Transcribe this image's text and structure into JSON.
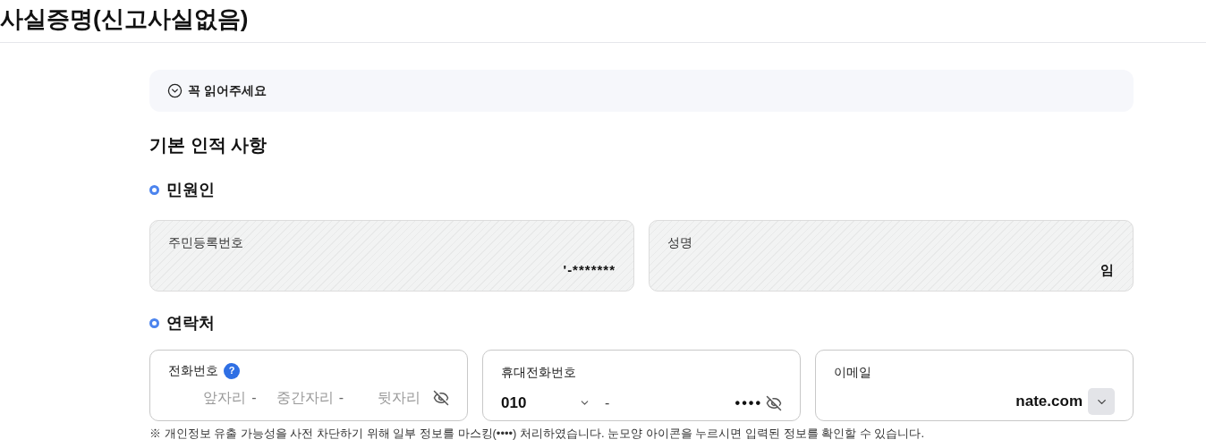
{
  "page_title": "사실증명(신고사실없음)",
  "notice": {
    "label": "꼭 읽어주세요",
    "expanded": false
  },
  "section_title": "기본 인적 사항",
  "applicant": {
    "title": "민원인",
    "fields": [
      {
        "label": "주민등록번호",
        "value": "'-*******"
      },
      {
        "label": "성명",
        "value": "임"
      }
    ]
  },
  "contact": {
    "title": "연락처",
    "phone": {
      "label": "전화번호",
      "help": "?",
      "parts": [
        {
          "placeholder": "앞자리",
          "sep": "-"
        },
        {
          "placeholder": "중간자리",
          "sep": "-"
        },
        {
          "placeholder": "뒷자리"
        }
      ]
    },
    "mobile": {
      "label": "휴대전화번호",
      "prefix": "010",
      "sep": "-",
      "masked": "••••"
    },
    "email": {
      "label": "이메일",
      "domain": "nate.com"
    }
  },
  "footnote": "※ 개인정보 유출 가능성을 사전 차단하기 위해 일부 정보를 마스킹(••••) 처리하였습니다. 눈모양 아이콘을 누르시면 입력된 정보를 확인할 수 있습니다."
}
